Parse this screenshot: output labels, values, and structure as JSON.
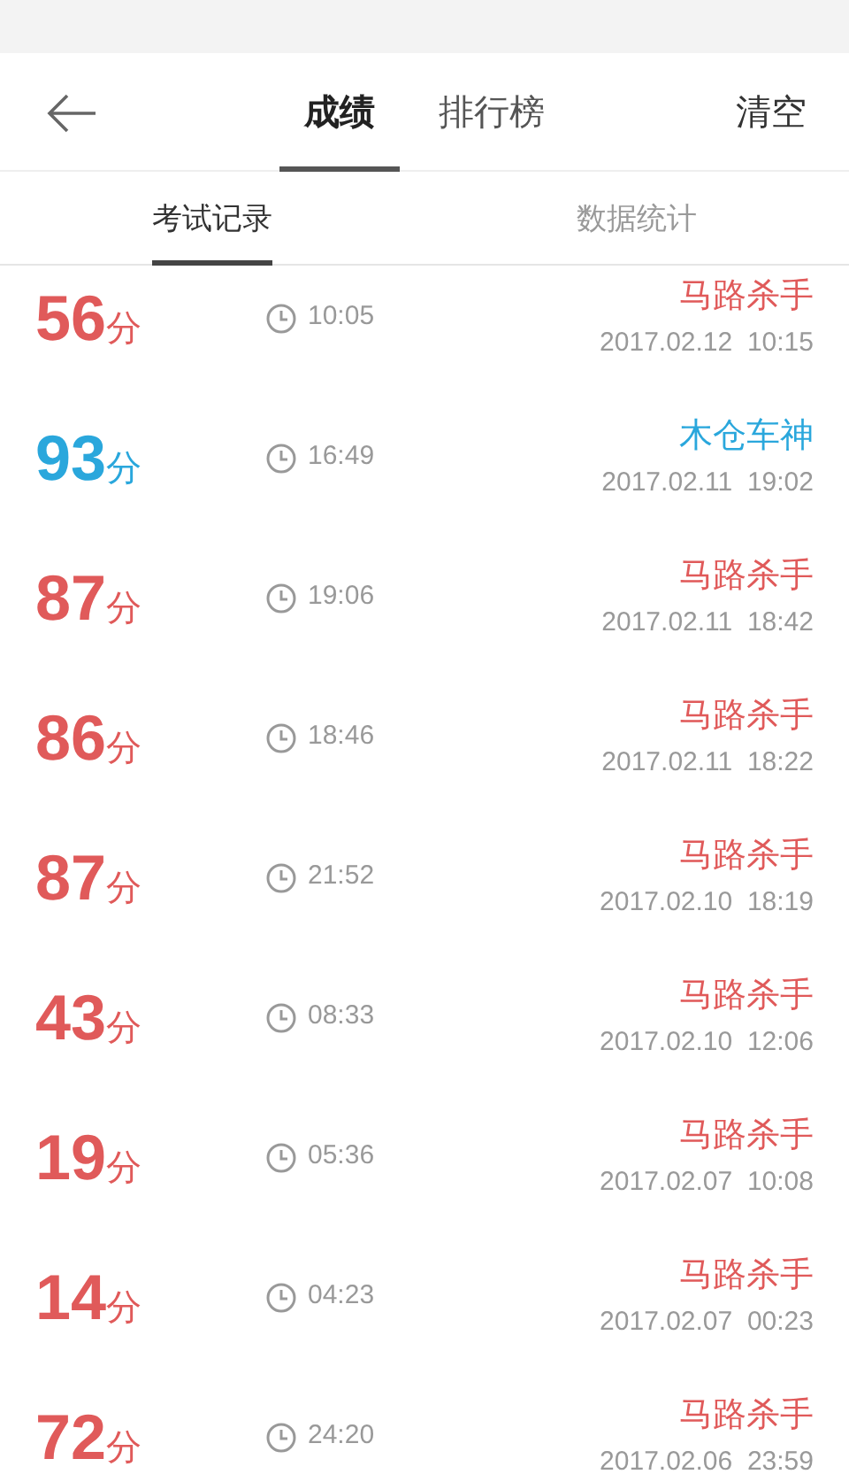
{
  "toolbar": {
    "tabs": [
      {
        "label": "成绩",
        "selected": true
      },
      {
        "label": "排行榜",
        "selected": false
      }
    ],
    "action": "清空"
  },
  "subtabs": [
    {
      "label": "考试记录",
      "selected": true
    },
    {
      "label": "数据统计",
      "selected": false
    }
  ],
  "records": [
    {
      "score": "56",
      "unit": "分",
      "duration": "10:05",
      "title": "马路杀手",
      "date": "2017.02.12  10:15",
      "color": "#e05a5a"
    },
    {
      "score": "93",
      "unit": "分",
      "duration": "16:49",
      "title": "木仓车神",
      "date": "2017.02.11  19:02",
      "color": "#2aa7dc"
    },
    {
      "score": "87",
      "unit": "分",
      "duration": "19:06",
      "title": "马路杀手",
      "date": "2017.02.11  18:42",
      "color": "#e05a5a"
    },
    {
      "score": "86",
      "unit": "分",
      "duration": "18:46",
      "title": "马路杀手",
      "date": "2017.02.11  18:22",
      "color": "#e05a5a"
    },
    {
      "score": "87",
      "unit": "分",
      "duration": "21:52",
      "title": "马路杀手",
      "date": "2017.02.10  18:19",
      "color": "#e05a5a"
    },
    {
      "score": "43",
      "unit": "分",
      "duration": "08:33",
      "title": "马路杀手",
      "date": "2017.02.10  12:06",
      "color": "#e05a5a"
    },
    {
      "score": "19",
      "unit": "分",
      "duration": "05:36",
      "title": "马路杀手",
      "date": "2017.02.07  10:08",
      "color": "#e05a5a"
    },
    {
      "score": "14",
      "unit": "分",
      "duration": "04:23",
      "title": "马路杀手",
      "date": "2017.02.07  00:23",
      "color": "#e05a5a"
    },
    {
      "score": "72",
      "unit": "分",
      "duration": "24:20",
      "title": "马路杀手",
      "date": "2017.02.06  23:59",
      "color": "#e05a5a"
    }
  ]
}
